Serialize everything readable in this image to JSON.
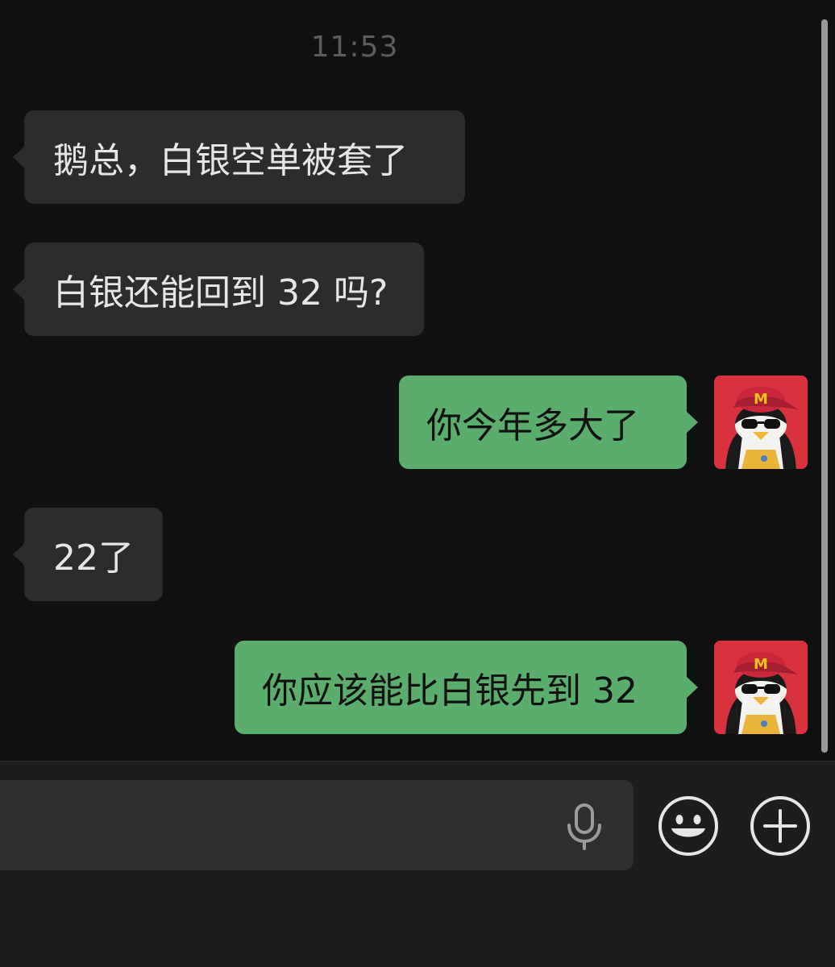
{
  "chat": {
    "timestamp": "11:53",
    "messages": [
      {
        "from": "other",
        "text": "鹅总，白银空单被套了"
      },
      {
        "from": "other",
        "text": "白银还能回到 32 吗?"
      },
      {
        "from": "me",
        "text": "你今年多大了"
      },
      {
        "from": "other",
        "text": "22了"
      },
      {
        "from": "me",
        "text": "你应该能比白银先到 32"
      }
    ]
  },
  "colors": {
    "background": "#111111",
    "incoming_bubble": "#2c2c2c",
    "outgoing_bubble": "#5aad6b",
    "avatar_background": "#d8323f"
  },
  "icons": {
    "voice": "microphone-icon",
    "emoji": "smiley-icon",
    "more": "plus-circle-icon"
  }
}
